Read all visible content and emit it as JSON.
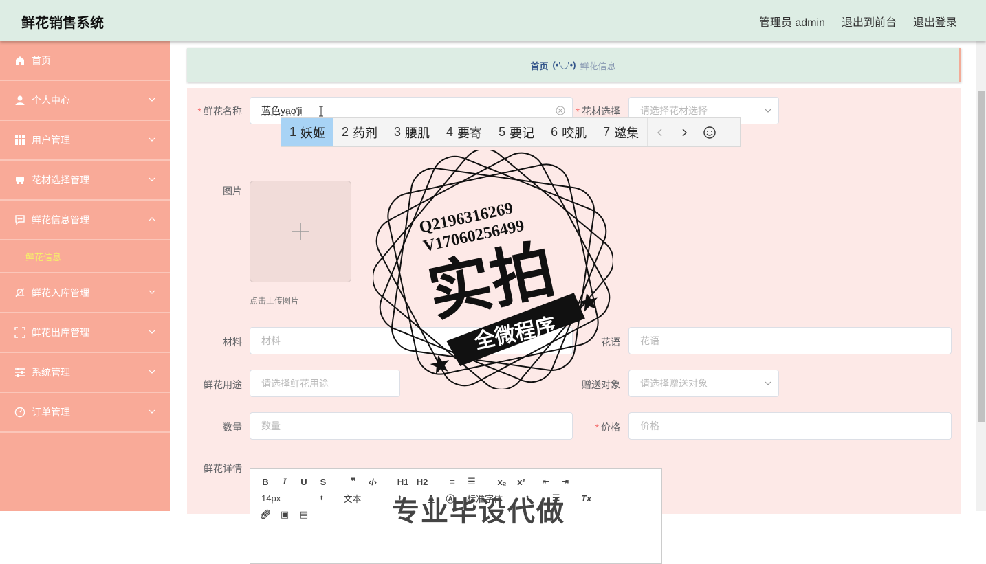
{
  "app": {
    "title": "鲜花销售系统"
  },
  "topnav": {
    "admin": "管理员 admin",
    "to_front": "退出到前台",
    "logout": "退出登录"
  },
  "sidebar": {
    "items": [
      {
        "label": "首页",
        "icon": "home-icon"
      },
      {
        "label": "个人中心",
        "icon": "user-icon"
      },
      {
        "label": "用户管理",
        "icon": "grid-icon"
      },
      {
        "label": "花材选择管理",
        "icon": "tag-icon"
      },
      {
        "label": "鲜花信息管理",
        "icon": "chat-icon",
        "expanded": true
      },
      {
        "label": "鲜花入库管理",
        "icon": "bell-off-icon"
      },
      {
        "label": "鲜花出库管理",
        "icon": "scan-icon"
      },
      {
        "label": "系统管理",
        "icon": "sliders-icon"
      },
      {
        "label": "订单管理",
        "icon": "dashboard-icon"
      }
    ],
    "sub": {
      "label": "鲜花信息"
    }
  },
  "breadcrumb": {
    "home": "首页",
    "face": "(•'◡'•)",
    "current": "鲜花信息"
  },
  "form": {
    "name": {
      "label": "鲜花名称",
      "value": "蓝色yao'ji"
    },
    "material_select": {
      "label": "花材选择",
      "placeholder": "请选择花材选择"
    },
    "image": {
      "label": "图片",
      "hint": "点击上传图片"
    },
    "material": {
      "label": "材料",
      "placeholder": "材料"
    },
    "flower_lang": {
      "label": "花语",
      "placeholder": "花语"
    },
    "usage": {
      "label": "鲜花用途",
      "placeholder": "请选择鲜花用途"
    },
    "gift_target": {
      "label": "赠送对象",
      "placeholder": "请选择赠送对象"
    },
    "quantity": {
      "label": "数量",
      "placeholder": "数量"
    },
    "price": {
      "label": "价格",
      "placeholder": "价格"
    },
    "detail": {
      "label": "鲜花详情"
    }
  },
  "editor": {
    "size": "14px",
    "block": "文本",
    "font": "标准字体",
    "h1": "H1",
    "h2": "H2",
    "preview_text": "专业毕设代做"
  },
  "ime": {
    "candidates": [
      {
        "num": "1",
        "text": "妖姬"
      },
      {
        "num": "2",
        "text": "药剂"
      },
      {
        "num": "3",
        "text": "腰肌"
      },
      {
        "num": "4",
        "text": "要寄"
      },
      {
        "num": "5",
        "text": "要记"
      },
      {
        "num": "6",
        "text": "咬肌"
      },
      {
        "num": "7",
        "text": "邀集"
      }
    ]
  },
  "watermark": {
    "line1": "Q2196316269",
    "line2": "V17060256499",
    "big": "实拍",
    "ribbon": "全微程序"
  },
  "colors": {
    "topbar": "#ddede4",
    "sidebar": "#f9aa98",
    "form_bg": "#fde9e7",
    "required": "#f56c6c",
    "submenu_active": "#f5ef6a"
  }
}
